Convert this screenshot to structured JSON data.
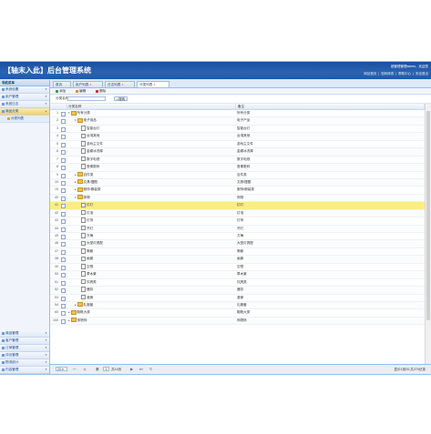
{
  "header": {
    "title": "【轴末入此】后台管理系统",
    "userline": "超管理管理admin，欢迎您",
    "links": [
      "网站首页",
      "|",
      "密码修改",
      "|",
      "帮助中心",
      "|",
      "安全退出"
    ]
  },
  "sidebar": {
    "heading": "导航菜单",
    "items": [
      {
        "label": "系统设置",
        "active": false
      },
      {
        "label": "用户管理",
        "active": false
      },
      {
        "label": "系统日志",
        "active": false
      },
      {
        "label": "商品分类",
        "active": true
      }
    ],
    "subitem": "分类列表",
    "bottom_items": [
      "商品管理",
      "客户管理",
      "订单管理",
      "评论管理",
      "物流统计",
      "内容管理"
    ]
  },
  "tabs": [
    {
      "label": "首页",
      "active": false
    },
    {
      "label": "用户列表",
      "active": false
    },
    {
      "label": "日志列表",
      "active": false
    },
    {
      "label": "分类列表",
      "active": true
    }
  ],
  "toolbar": {
    "add": "添加",
    "edit": "编辑",
    "delete": "删除"
  },
  "search": {
    "label": "分类名称:",
    "value": "",
    "button": "搜索"
  },
  "grid": {
    "headers": {
      "name": "分类名称",
      "note": "备注"
    },
    "rows": [
      {
        "n": "1",
        "depth": 0,
        "type": "folder",
        "open": true,
        "name": "所有分类",
        "note": "所有分类"
      },
      {
        "n": "2",
        "depth": 1,
        "type": "folder",
        "open": true,
        "name": "电子用品",
        "note": "电子产品"
      },
      {
        "n": "3",
        "depth": 2,
        "type": "leaf",
        "name": "智能台灯",
        "note": "智能台灯"
      },
      {
        "n": "4",
        "depth": 2,
        "type": "leaf",
        "name": "台湾其他",
        "note": "台湾其他"
      },
      {
        "n": "5",
        "depth": 2,
        "type": "leaf",
        "name": "游戏主文件",
        "note": "游戏主文件"
      },
      {
        "n": "6",
        "depth": 2,
        "type": "leaf",
        "name": "金碟冰洗厚",
        "note": "金碟冰洗厚"
      },
      {
        "n": "7",
        "depth": 2,
        "type": "leaf",
        "name": "数字电视",
        "note": "数字电视"
      },
      {
        "n": "8",
        "depth": 2,
        "type": "leaf",
        "name": "音像数码",
        "note": "音像数码"
      },
      {
        "n": "9",
        "depth": 1,
        "type": "folder",
        "open": false,
        "name": "百件类",
        "note": "百件类"
      },
      {
        "n": "10",
        "depth": 1,
        "type": "folder",
        "open": false,
        "name": "文具/摆图",
        "note": "文具/摆图"
      },
      {
        "n": "15",
        "depth": 1,
        "type": "folder",
        "open": false,
        "name": "服饰/服装类",
        "note": "服饰/服装类"
      },
      {
        "n": "40",
        "depth": 1,
        "type": "folder",
        "open": true,
        "name": "饰物",
        "note": "饰物"
      },
      {
        "n": "41",
        "depth": 2,
        "type": "leaf",
        "name": "灯灯",
        "note": "灯灯",
        "selected": true
      },
      {
        "n": "42",
        "depth": 2,
        "type": "leaf",
        "name": "灯泡",
        "note": "灯泡"
      },
      {
        "n": "43",
        "depth": 2,
        "type": "leaf",
        "name": "灯饰",
        "note": "灯饰"
      },
      {
        "n": "44",
        "depth": 2,
        "type": "leaf",
        "name": "开灯",
        "note": "开灯"
      },
      {
        "n": "45",
        "depth": 2,
        "type": "leaf",
        "name": "方梅",
        "note": "方梅"
      },
      {
        "n": "46",
        "depth": 2,
        "type": "leaf",
        "name": "大型灯具配",
        "note": "大型灯具配"
      },
      {
        "n": "47",
        "depth": 2,
        "type": "leaf",
        "name": "筒套",
        "note": "筒套"
      },
      {
        "n": "48",
        "depth": 2,
        "type": "leaf",
        "name": "画景",
        "note": "画景"
      },
      {
        "n": "49",
        "depth": 2,
        "type": "leaf",
        "name": "空想",
        "note": "空想"
      },
      {
        "n": "50",
        "depth": 2,
        "type": "leaf",
        "name": "草木景",
        "note": "草木景"
      },
      {
        "n": "51",
        "depth": 2,
        "type": "leaf",
        "name": "饮具类",
        "note": "饮具类"
      },
      {
        "n": "52",
        "depth": 2,
        "type": "leaf",
        "name": "器扣",
        "note": "器扣"
      },
      {
        "n": "53",
        "depth": 2,
        "type": "leaf",
        "name": "灌席",
        "note": "灌席"
      },
      {
        "n": "54",
        "depth": 1,
        "type": "folder",
        "open": false,
        "name": "礼服套",
        "note": "礼服套"
      },
      {
        "n": "65",
        "depth": 0,
        "type": "folder",
        "open": false,
        "name": "鞋靴大类",
        "note": "鞋靴大类"
      },
      {
        "n": "100",
        "depth": 0,
        "type": "folder",
        "open": false,
        "name": "饰物饰",
        "note": "饰物饰"
      }
    ]
  },
  "pager": {
    "page_size": "20",
    "page_label": "第",
    "page_value": "1",
    "page_total": "共14页",
    "info": "显示1到20,共270记录"
  },
  "colors": {
    "header": "#1e5aa8",
    "selected_row": "#fbec88",
    "active_sidebar": "#f5cf6c"
  }
}
